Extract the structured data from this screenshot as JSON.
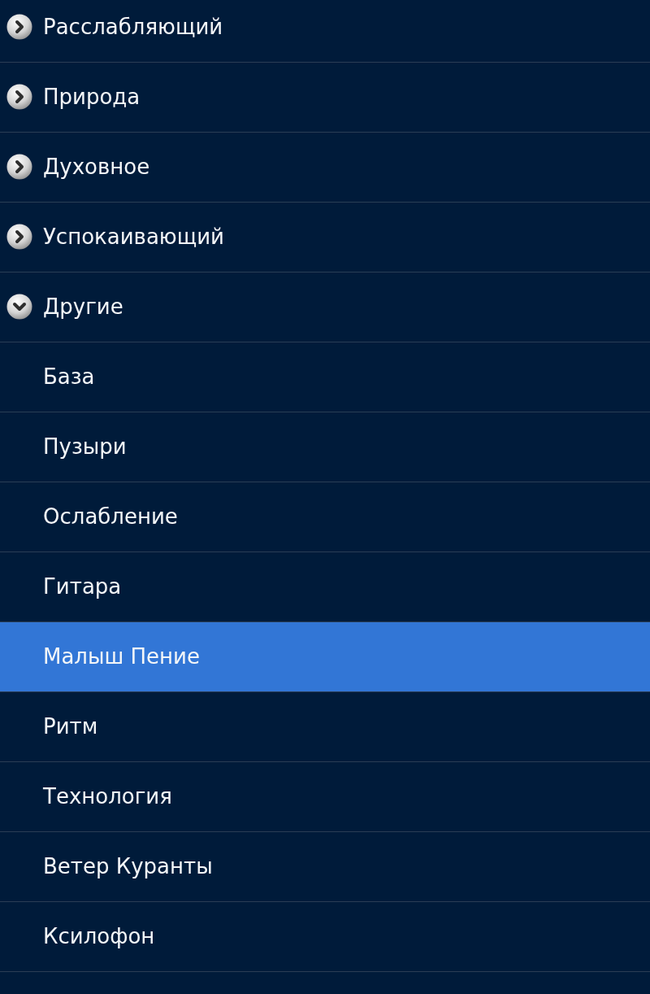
{
  "groups": [
    {
      "label": "Расслабляющий",
      "expanded": false
    },
    {
      "label": "Природа",
      "expanded": false
    },
    {
      "label": "Духовное",
      "expanded": false
    },
    {
      "label": "Успокаивающий",
      "expanded": false
    },
    {
      "label": "Другие",
      "expanded": true,
      "children": [
        {
          "label": "База",
          "selected": false
        },
        {
          "label": "Пузыри",
          "selected": false
        },
        {
          "label": "Ослабление",
          "selected": false
        },
        {
          "label": "Гитара",
          "selected": false
        },
        {
          "label": "Малыш Пение",
          "selected": true
        },
        {
          "label": "Ритм",
          "selected": false
        },
        {
          "label": "Технология",
          "selected": false
        },
        {
          "label": "Ветер Куранты",
          "selected": false
        },
        {
          "label": "Ксилофон",
          "selected": false
        }
      ]
    }
  ]
}
